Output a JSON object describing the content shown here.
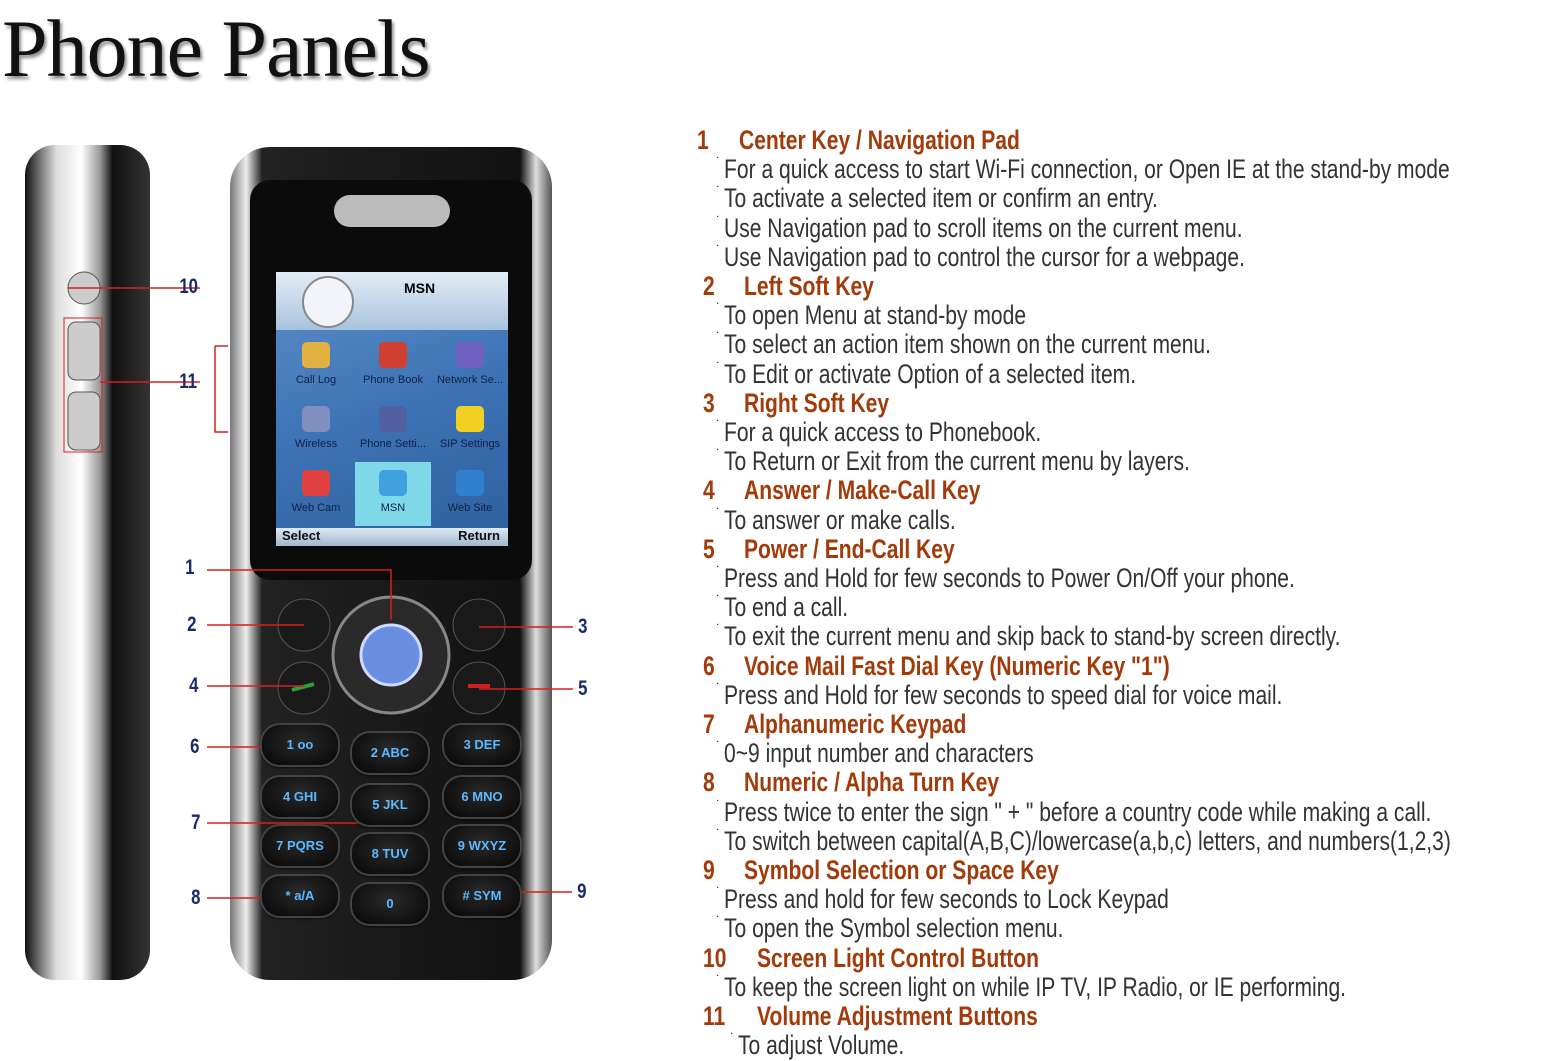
{
  "title": "Phone Panels",
  "phone": {
    "screen": {
      "header": "MSN",
      "apps": [
        "Call Log",
        "Phone Book",
        "Network Se...",
        "Wireless",
        "Phone Setti...",
        "SIP Settings",
        "Web Cam",
        "MSN",
        "Web Site"
      ],
      "selected": "MSN",
      "left_soft": "Select",
      "right_soft": "Return"
    },
    "keys": [
      "1 oo",
      "2 ABC",
      "3 DEF",
      "4 GHI",
      "5 JKL",
      "6 MNO",
      "7 PQRS",
      "8 TUV",
      "9 WXYZ",
      "* a/A",
      "0",
      "# SYM"
    ],
    "callouts": [
      "1",
      "2",
      "3",
      "4",
      "5",
      "6",
      "7",
      "8",
      "9",
      "10",
      "11"
    ],
    "callout_color": "#d42020"
  },
  "items": [
    {
      "num": "1",
      "title": "Center Key / Navigation Pad",
      "lines": [
        "For a quick access to start Wi-Fi connection, or Open IE at the stand-by mode",
        "To activate a selected item or confirm an entry.",
        "Use Navigation pad to scroll items on the current menu.",
        "Use Navigation pad to control the cursor for a webpage."
      ]
    },
    {
      "num": "2",
      "title": "Left Soft Key",
      "lines": [
        "To open Menu at stand-by mode",
        "To select an action item shown on the current menu.",
        "To Edit or activate Option of a selected item."
      ]
    },
    {
      "num": "3",
      "title": "Right Soft Key",
      "lines": [
        "For a quick access to Phonebook.",
        "To Return or Exit from the current menu by layers."
      ]
    },
    {
      "num": "4",
      "title": "Answer / Make-Call Key",
      "lines": [
        "To answer or make calls."
      ]
    },
    {
      "num": "5",
      "title": "Power / End-Call Key",
      "lines": [
        "Press and Hold for few seconds to Power On/Off your phone.",
        "To end a call.",
        "To exit the current menu and skip back to stand-by screen directly."
      ]
    },
    {
      "num": "6",
      "title": "Voice Mail Fast Dial Key (Numeric Key \"1\")",
      "lines": [
        "Press and Hold for few seconds to speed dial for voice mail."
      ]
    },
    {
      "num": "7",
      "title": "Alphanumeric Keypad",
      "lines": [
        "0~9 input number and characters"
      ]
    },
    {
      "num": "8",
      "title": "Numeric / Alpha Turn Key",
      "lines": [
        "Press twice to enter the sign \" + \" before a country code while making a call.",
        "To switch between capital(A,B,C)/lowercase(a,b,c) letters, and numbers(1,2,3)"
      ]
    },
    {
      "num": "9",
      "title": "Symbol Selection or Space Key",
      "lines": [
        "Press and hold for few seconds to Lock Keypad",
        "To open the Symbol selection menu."
      ]
    },
    {
      "num": "10",
      "title": "Screen Light Control Button",
      "lines": [
        "To keep the screen light on while IP TV, IP Radio, or IE performing."
      ]
    },
    {
      "num": "11",
      "title": "Volume Adjustment Buttons",
      "lines": [
        "To adjust Volume."
      ]
    }
  ],
  "colors": {
    "heading": "#a33a0a",
    "body": "#333333"
  }
}
